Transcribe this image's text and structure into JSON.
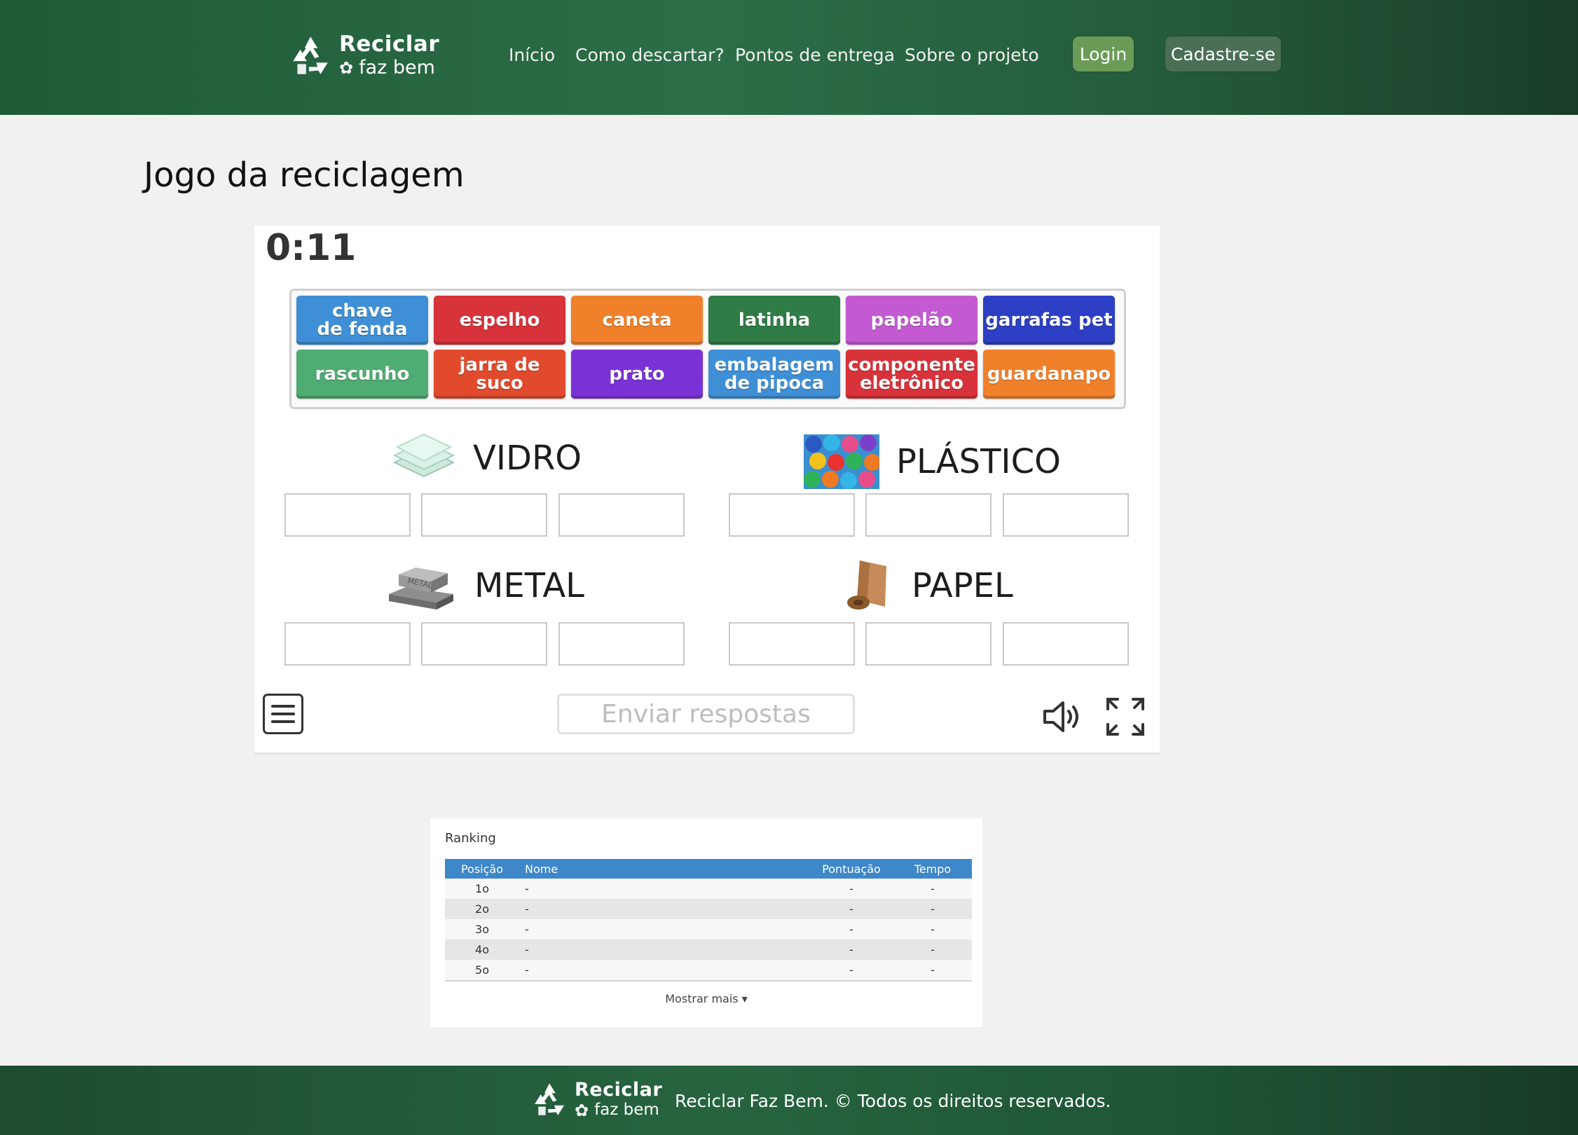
{
  "brand": {
    "line1": "Reciclar",
    "line2": "faz bem"
  },
  "nav": {
    "items": [
      "Início",
      "Como descartar?",
      "Pontos de entrega",
      "Sobre o projeto"
    ],
    "login": "Login",
    "signup": "Cadastre-se"
  },
  "page": {
    "title": "Jogo da reciclagem"
  },
  "game": {
    "timer": "0:11",
    "tiles": [
      {
        "line1": "chave",
        "line2": "de fenda",
        "color": "#3f8fd6"
      },
      {
        "line1": "espelho",
        "line2": "",
        "color": "#d8323a"
      },
      {
        "line1": "caneta",
        "line2": "",
        "color": "#f1802a"
      },
      {
        "line1": "latinha",
        "line2": "",
        "color": "#2f7c46"
      },
      {
        "line1": "papelão",
        "line2": "",
        "color": "#c35ad2"
      },
      {
        "line1": "garrafas pet",
        "line2": "",
        "color": "#2d3fc4"
      },
      {
        "line1": "rascunho",
        "line2": "",
        "color": "#4fac72"
      },
      {
        "line1": "jarra de suco",
        "line2": "",
        "color": "#e24a2d"
      },
      {
        "line1": "prato",
        "line2": "",
        "color": "#7a32d6"
      },
      {
        "line1": "embalagem",
        "line2": "de pipoca",
        "color": "#3f8fd6"
      },
      {
        "line1": "componente",
        "line2": "eletrônico",
        "color": "#d8323a"
      },
      {
        "line1": "guardanapo",
        "line2": "",
        "color": "#f1802a"
      }
    ],
    "categories": [
      {
        "name": "VIDRO",
        "icon": "glass-sheets-icon"
      },
      {
        "name": "PLÁSTICO",
        "icon": "plastic-caps-icon"
      },
      {
        "name": "METAL",
        "icon": "metal-ingots-icon"
      },
      {
        "name": "PAPEL",
        "icon": "paper-roll-icon"
      }
    ],
    "send_label": "Enviar respostas",
    "icons": {
      "menu": "menu-icon",
      "sound": "speaker-icon",
      "fullscreen": "fullscreen-icon"
    }
  },
  "ranking": {
    "title": "Ranking",
    "columns": [
      "Posição",
      "Nome",
      "Pontuação",
      "Tempo"
    ],
    "rows": [
      [
        "1o",
        "-",
        "-",
        "-"
      ],
      [
        "2o",
        "-",
        "-",
        "-"
      ],
      [
        "3o",
        "-",
        "-",
        "-"
      ],
      [
        "4o",
        "-",
        "-",
        "-"
      ],
      [
        "5o",
        "-",
        "-",
        "-"
      ]
    ],
    "show_more": "Mostrar mais ▾"
  },
  "footer": {
    "text": "Reciclar Faz Bem. © Todos os direitos reservados."
  },
  "colors": {
    "header_green": "#2c6e48",
    "login": "#6b9c57",
    "signup": "#4a6f55",
    "table_header": "#3e87c9"
  }
}
